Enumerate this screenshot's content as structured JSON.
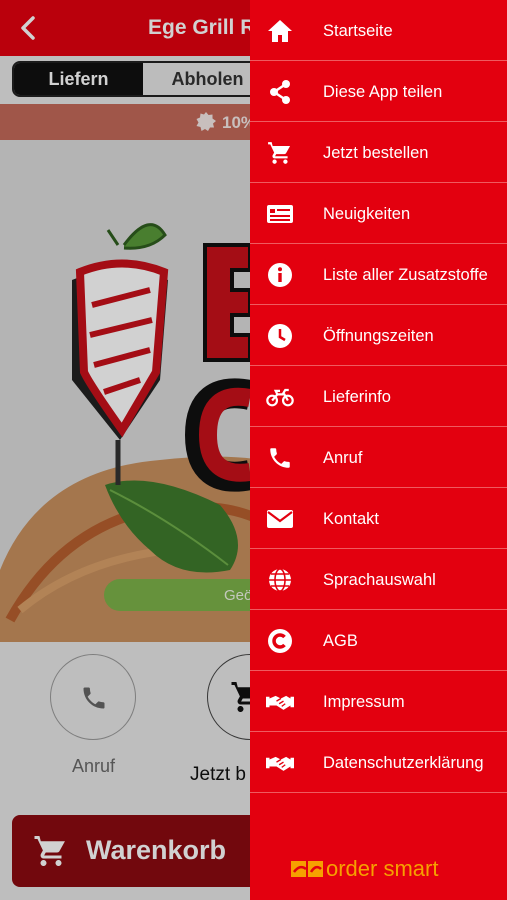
{
  "header": {
    "title": "Ege Grill Res",
    "back_icon": "back-arrow-icon"
  },
  "order_mode": {
    "options": [
      "Liefern",
      "Abholen"
    ],
    "selected": "Liefern"
  },
  "promo": {
    "text": "10%",
    "icon": "badge-icon"
  },
  "hero": {
    "location_button": "Geö"
  },
  "quick_actions": {
    "call_label": "Anruf",
    "order_label": "Jetzt b"
  },
  "basket": {
    "label": "Warenkorb"
  },
  "drawer": {
    "items": [
      {
        "label": "Startseite",
        "icon": "home-icon"
      },
      {
        "label": "Diese App teilen",
        "icon": "share-icon"
      },
      {
        "label": "Jetzt bestellen",
        "icon": "cart-icon"
      },
      {
        "label": "Neuigkeiten",
        "icon": "news-icon"
      },
      {
        "label": "Liste aller Zusatzstoffe",
        "icon": "info-icon"
      },
      {
        "label": "Öffnungszeiten",
        "icon": "clock-icon"
      },
      {
        "label": "Lieferinfo",
        "icon": "motorbike-icon"
      },
      {
        "label": "Anruf",
        "icon": "phone-icon"
      },
      {
        "label": "Kontakt",
        "icon": "mail-icon"
      },
      {
        "label": "Sprachauswahl",
        "icon": "globe-icon"
      },
      {
        "label": "AGB",
        "icon": "copyright-icon"
      },
      {
        "label": "Impressum",
        "icon": "handshake-icon"
      },
      {
        "label": "Datenschutzerklärung",
        "icon": "handshake-icon"
      }
    ],
    "brand": "order smart"
  },
  "colors": {
    "primary": "#e3000f",
    "dark_red": "#8c0a10",
    "brand_orange": "#f6a000",
    "green": "#7db24a"
  }
}
